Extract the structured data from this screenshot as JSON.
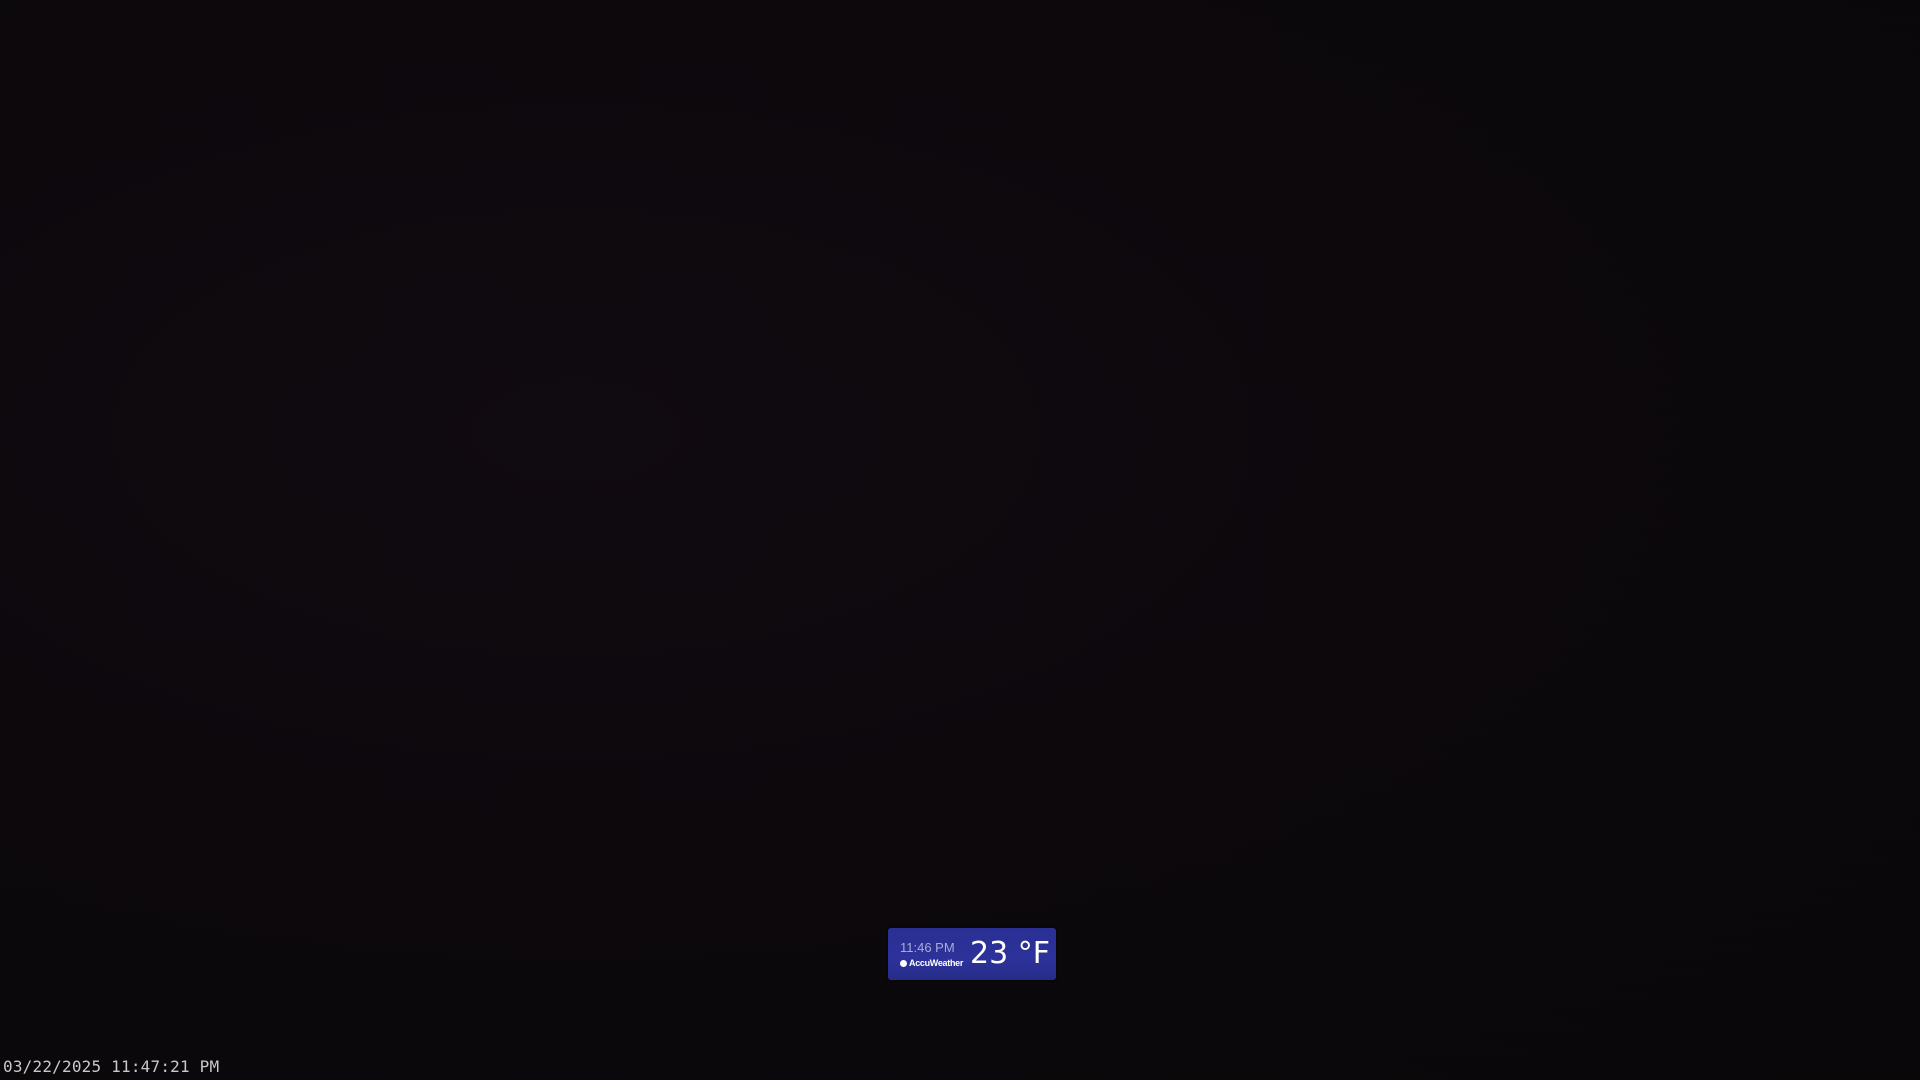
{
  "weather_widget": {
    "time": "11:46 PM",
    "brand": "AccuWeather",
    "temperature": "23 °F",
    "background_color": "#2c329a"
  },
  "camera": {
    "timestamp": "03/22/2025 11:47:21 PM",
    "background_color": "#0b080b"
  }
}
